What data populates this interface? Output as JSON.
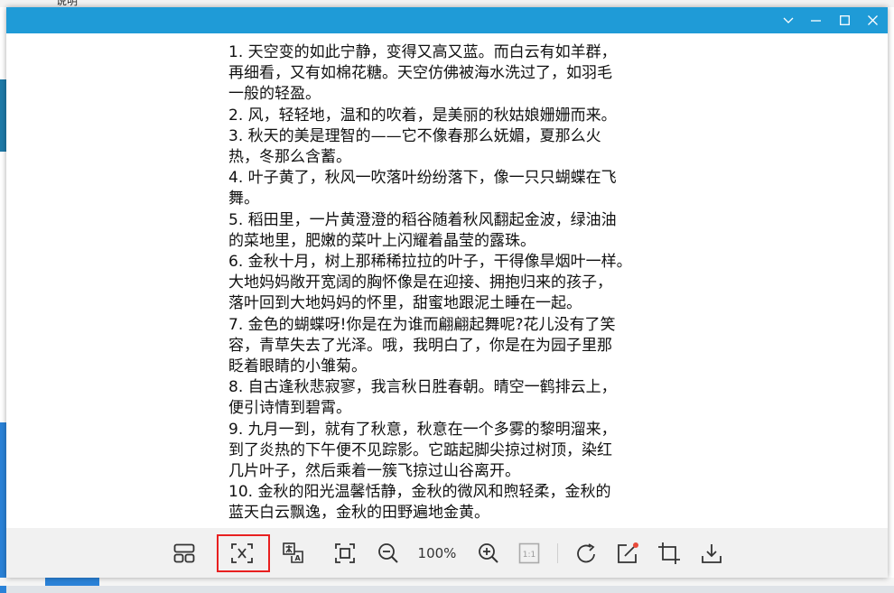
{
  "background_app": {
    "tab_text": "说明"
  },
  "window": {
    "controls": [
      {
        "name": "chevron-down-icon"
      },
      {
        "name": "minimize-icon"
      },
      {
        "name": "maximize-icon"
      },
      {
        "name": "close-icon"
      }
    ],
    "accent_color": "#1f9bd7"
  },
  "document": {
    "lines": [
      "1. 天空变的如此宁静，变得又高又蓝。而白云有如羊群，",
      "再细看，又有如棉花糖。天空仿佛被海水洗过了，如羽毛",
      "一般的轻盈。",
      "  2. 风，轻轻地，温和的吹着，是美丽的秋姑娘姗姗而来。",
      "  3. 秋天的美是理智的——它不像春那么妩媚，夏那么火",
      "热，冬那么含蓄。",
      "  4. 叶子黄了，秋风一吹落叶纷纷落下，像一只只蝴蝶在飞",
      "舞。",
      "  5. 稻田里，一片黄澄澄的稻谷随着秋风翻起金波，绿油油",
      "的菜地里，肥嫩的菜叶上闪耀着晶莹的露珠。",
      "   6. 金秋十月，树上那稀稀拉拉的叶子，干得像旱烟叶一样。",
      "大地妈妈敞开宽阔的胸怀像是在迎接、拥抱归来的孩子，",
      "落叶回到大地妈妈的怀里，甜蜜地跟泥土睡在一起。",
      "  7. 金色的蝴蝶呀!你是在为谁而翩翩起舞呢?花儿没有了笑",
      "容，青草失去了光泽。哦，我明白了，你是在为园子里那",
      "眨着眼睛的小雏菊。",
      "  8. 自古逢秋悲寂寥，我言秋日胜春朝。晴空一鹤排云上，",
      "便引诗情到碧霄。",
      "  9. 九月一到，就有了秋意，秋意在一个多雾的黎明溜来，",
      "到了炎热的下午便不见踪影。它踮起脚尖掠过树顶，染红",
      "几片叶子，然后乘着一簇飞掠过山谷离开。",
      "  10. 金秋的阳光温馨恬静，金秋的微风和煦轻柔，金秋的",
      "蓝天白云飘逸，金秋的田野遍地金黄。"
    ]
  },
  "toolbar": {
    "zoom_level": "100%",
    "one_to_one_label": "1:1",
    "tools": [
      {
        "name": "layout-grid-icon"
      },
      {
        "name": "text-extract-icon",
        "highlighted": true
      },
      {
        "name": "translate-icon"
      },
      {
        "name": "fit-screen-icon"
      },
      {
        "name": "zoom-out-icon"
      },
      {
        "name": "zoom-in-icon"
      },
      {
        "name": "actual-size-icon"
      },
      {
        "name": "rotate-icon"
      },
      {
        "name": "edit-icon"
      },
      {
        "name": "crop-icon"
      },
      {
        "name": "download-icon"
      }
    ],
    "highlight_color": "#e82020",
    "badge_color": "#e84a3a"
  }
}
